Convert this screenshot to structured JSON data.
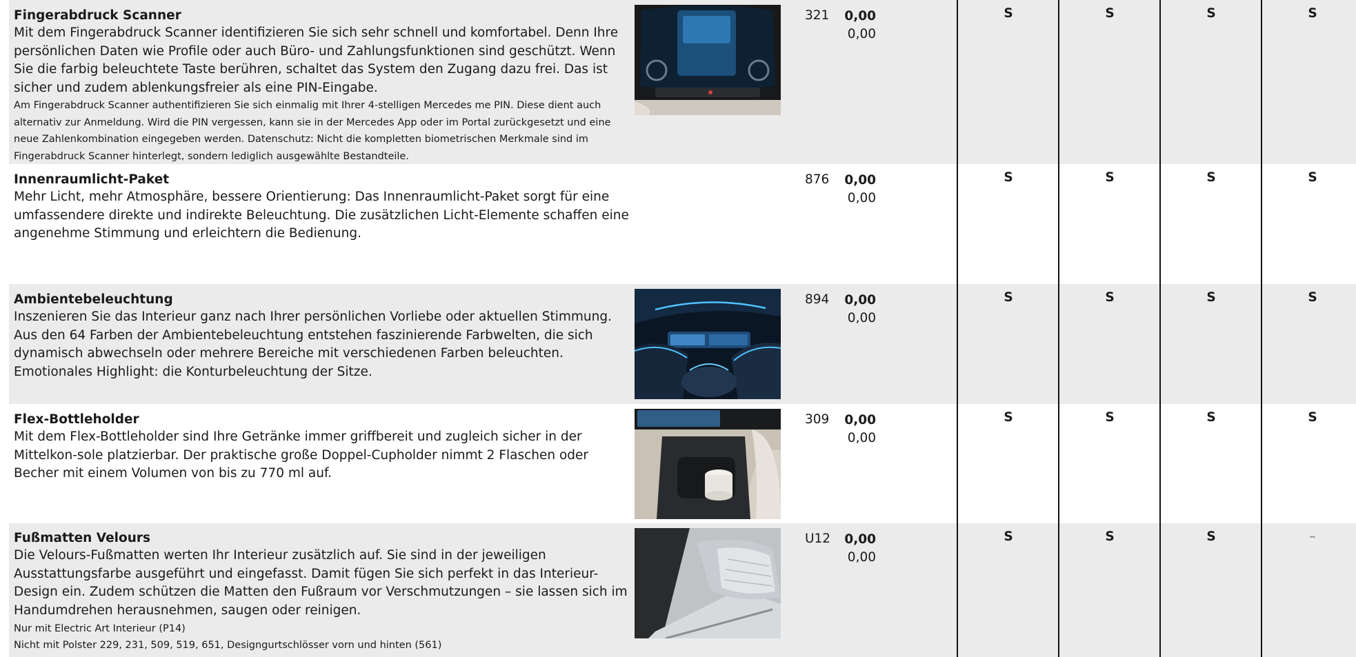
{
  "rows": [
    {
      "title": "Fingerabdruck Scanner",
      "body": "Mit dem Fingerabdruck Scanner identifizieren Sie sich sehr schnell und komfortabel. Denn Ihre persönlichen Daten wie Profile oder auch Büro- und Zahlungsfunktionen sind geschützt. Wenn Sie die farbig beleuchtete Taste berühren, schaltet das System den Zugang dazu frei. Das ist sicher und zudem ablenkungsfreier als eine PIN-Eingabe.",
      "notes": [
        "Am Fingerabdruck Scanner authentifizieren Sie sich einmalig mit Ihrer 4-stelligen Mercedes me PIN. Diese dient auch alternativ zur Anmeldung. Wird die PIN vergessen, kann sie in der Mercedes App oder im Portal zurückgesetzt und eine neue Zahlenkombination eingegeben werden. Datenschutz: Nicht die kompletten biometrischen Merkmale sind im Fingerabdruck Scanner hinterlegt, sondern lediglich ausgewählte Bestandteile."
      ],
      "code": "321",
      "price_primary": "0,00",
      "price_secondary": "0,00",
      "availability": [
        "S",
        "S",
        "S",
        "S"
      ],
      "image_icon": "dashboard-touchscreen-photo"
    },
    {
      "title": "Innenraumlicht-Paket",
      "body": "Mehr Licht, mehr Atmosphäre, bessere Orientierung: Das Innenraumlicht-Paket sorgt für eine umfassendere direkte und indirekte Beleuchtung. Die zusätzlichen Licht-Elemente schaffen eine angenehme Stimmung und erleichtern die Bedienung.",
      "notes": [],
      "code": "876",
      "price_primary": "0,00",
      "price_secondary": "0,00",
      "availability": [
        "S",
        "S",
        "S",
        "S"
      ]
    },
    {
      "title": "Ambientebeleuchtung",
      "body": "Inszenieren Sie das Interieur ganz nach Ihrer persönlichen Vorliebe oder aktuellen Stimmung. Aus den 64 Farben der Ambientebeleuchtung entstehen faszinierende Farbwelten, die sich dynamisch abwechseln oder mehrere Bereiche mit verschiedenen Farben beleuchten. Emotionales Highlight: die Konturbeleuchtung der Sitze.",
      "notes": [],
      "code": "894",
      "price_primary": "0,00",
      "price_secondary": "0,00",
      "availability": [
        "S",
        "S",
        "S",
        "S"
      ],
      "image_icon": "ambient-lighting-interior-photo"
    },
    {
      "title": "Flex-Bottleholder",
      "body": "Mit dem Flex-Bottleholder sind Ihre Getränke immer griffbereit und zugleich sicher in der Mittelkon-sole platzierbar. Der praktische große Doppel-Cupholder nimmt 2 Flaschen oder Becher mit einem Volumen von bis zu 770 ml auf.",
      "notes": [],
      "code": "309",
      "price_primary": "0,00",
      "price_secondary": "0,00",
      "availability": [
        "S",
        "S",
        "S",
        "S"
      ],
      "image_icon": "center-console-cupholder-photo"
    },
    {
      "title": "Fußmatten Velours",
      "body": "Die Velours-Fußmatten werten Ihr Interieur zusätzlich auf. Sie sind in der jeweiligen Ausstattungsfarbe ausgeführt und eingefasst. Damit fügen Sie sich perfekt in das Interieur-Design ein. Zudem schützen die Matten den Fußraum vor Verschmutzungen – sie lassen sich im Handumdrehen herausnehmen, saugen oder reinigen.",
      "notes": [
        "Nur mit Electric Art Interieur (P14)",
        "Nicht mit Polster 229, 231, 509, 519, 651, Designgurtschlösser vorn und hinten (561)"
      ],
      "code": "U12",
      "price_primary": "0,00",
      "price_secondary": "0,00",
      "availability": [
        "S",
        "S",
        "S",
        "–"
      ],
      "image_icon": "floor-mats-interior-photo"
    }
  ],
  "colors": {
    "row_shade": "#ebebeb",
    "divider": "#111111",
    "ambient_accent": "#4fc3ff"
  }
}
